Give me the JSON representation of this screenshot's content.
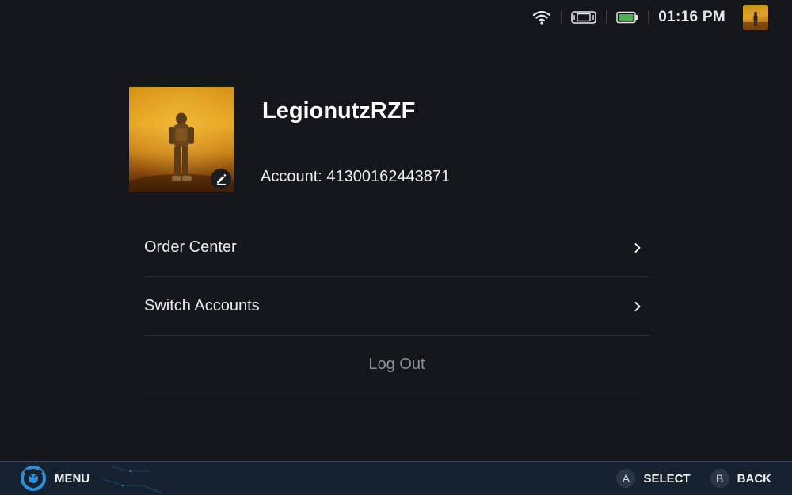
{
  "status_bar": {
    "wifi_icon": "wifi-icon",
    "controller_icon": "handheld-device-icon",
    "battery_icon": "battery-icon",
    "battery_color": "#4caf50",
    "time": "01:16 PM"
  },
  "profile": {
    "username": "LegionutzRZF",
    "account": "Account: 41300162443871",
    "edit_icon": "pencil-icon"
  },
  "menu": {
    "items": [
      {
        "label": "Order Center",
        "icon": "chevron-right-icon"
      },
      {
        "label": "Switch Accounts",
        "icon": "chevron-right-icon"
      }
    ],
    "logout_label": "Log Out"
  },
  "bottom_bar": {
    "menu_label": "MENU",
    "select_button": "A",
    "select_label": "SELECT",
    "back_button": "B",
    "back_label": "BACK"
  },
  "colors": {
    "background": "#15171d",
    "bottom_bar": "#172230",
    "accent_blue": "#2f8fd8"
  }
}
